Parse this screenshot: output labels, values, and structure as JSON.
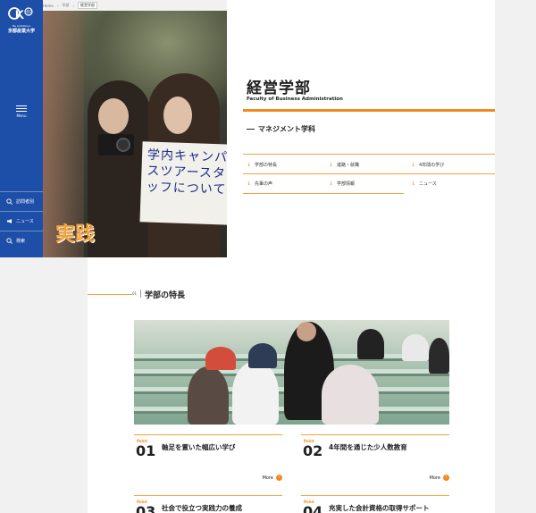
{
  "sidebar": {
    "logo_mark": "K",
    "logo_sub": "Be Ambitious",
    "logo_jp": "京都産業大学",
    "menu_label": "Menu",
    "links": [
      {
        "label": "訪問者別",
        "icon": "search-icon"
      },
      {
        "label": "ニュース",
        "icon": "megaphone-icon"
      },
      {
        "label": "検索",
        "icon": "search-icon"
      }
    ],
    "bg_color": "#1e4fa8"
  },
  "breadcrumb": [
    "Home",
    "学部",
    "経営学部"
  ],
  "hero": {
    "caption": "実践",
    "board_text": "学内キャンパスツアースタッフについて"
  },
  "header": {
    "title": "経営学部",
    "title_en": "Faculty of Business Administration",
    "major": "マネジメント学科",
    "accent_color": "#f08a1e",
    "links": [
      "学部の特長",
      "進路・就職",
      "4年間の学び",
      "先輩の声",
      "学部情報",
      "ニュース"
    ]
  },
  "section": {
    "number": "01",
    "title": "学部の特長",
    "points": [
      {
        "label": "Point",
        "num": "01",
        "text": "軸足を置いた幅広い学び",
        "more": "More"
      },
      {
        "label": "Point",
        "num": "02",
        "text": "4年間を通じた少人数教育",
        "more": "More"
      },
      {
        "label": "Point",
        "num": "03",
        "text": "社会で役立つ実践力の養成",
        "more": "More"
      },
      {
        "label": "Point",
        "num": "04",
        "text": "充実した会計資格の取得サポート",
        "more": "More"
      }
    ]
  }
}
